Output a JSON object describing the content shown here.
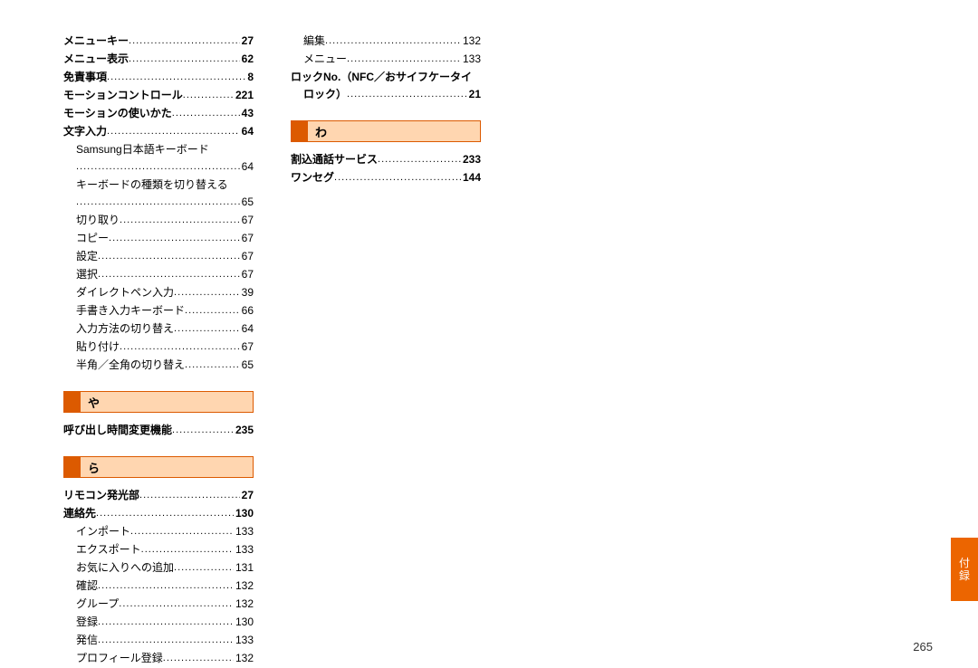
{
  "page_number": "265",
  "side_tab": "付録",
  "left": {
    "top_entries": [
      {
        "label": "メニューキー",
        "page": "27",
        "bold": true
      },
      {
        "label": "メニュー表示",
        "page": "62",
        "bold": true
      },
      {
        "label": "免責事項",
        "page": "8",
        "bold": true
      },
      {
        "label": "モーションコントロール",
        "page": "221",
        "bold": true
      },
      {
        "label": "モーションの使いかた",
        "page": "43",
        "bold": true
      },
      {
        "label": "文字入力",
        "page": "64",
        "bold": true
      }
    ],
    "text_input_wrap": "Samsung日本語キーボード",
    "text_input_sub_page": "64",
    "text_input_switch": "キーボードの種類を切り替える",
    "text_input_switch_page": "65",
    "text_input_subs": [
      {
        "label": "切り取り",
        "page": "67"
      },
      {
        "label": "コピー",
        "page": "67"
      },
      {
        "label": "設定",
        "page": "67"
      },
      {
        "label": "選択",
        "page": "67"
      },
      {
        "label": "ダイレクトペン入力",
        "page": "39"
      },
      {
        "label": "手書き入力キーボード",
        "page": "66"
      },
      {
        "label": "入力方法の切り替え",
        "page": "64"
      },
      {
        "label": "貼り付け",
        "page": "67"
      },
      {
        "label": "半角／全角の切り替え",
        "page": "65"
      }
    ],
    "section_ya": "や",
    "ya_entries": [
      {
        "label": "呼び出し時間変更機能",
        "page": "235",
        "bold": true
      }
    ],
    "section_ra": "ら",
    "ra_entries": [
      {
        "label": "リモコン発光部",
        "page": "27",
        "bold": true
      },
      {
        "label": "連絡先",
        "page": "130",
        "bold": true
      }
    ],
    "ra_subs": [
      {
        "label": "インポート",
        "page": "133"
      },
      {
        "label": "エクスポート",
        "page": "133"
      },
      {
        "label": "お気に入りへの追加",
        "page": "131"
      },
      {
        "label": "確認",
        "page": "132"
      },
      {
        "label": "グループ",
        "page": "132"
      },
      {
        "label": "登録",
        "page": "130"
      },
      {
        "label": "発信",
        "page": "133"
      },
      {
        "label": "プロフィール登録",
        "page": "132"
      }
    ]
  },
  "right": {
    "top_subs": [
      {
        "label": "編集",
        "page": "132"
      },
      {
        "label": "メニュー",
        "page": "133"
      }
    ],
    "lock_label": "ロックNo.（NFC／おサイフケータイ",
    "lock_label2": "ロック）",
    "lock_page": "21",
    "section_wa": "わ",
    "wa_entries": [
      {
        "label": "割込通話サービス",
        "page": "233",
        "bold": true
      },
      {
        "label": "ワンセグ",
        "page": "144",
        "bold": true
      }
    ]
  }
}
